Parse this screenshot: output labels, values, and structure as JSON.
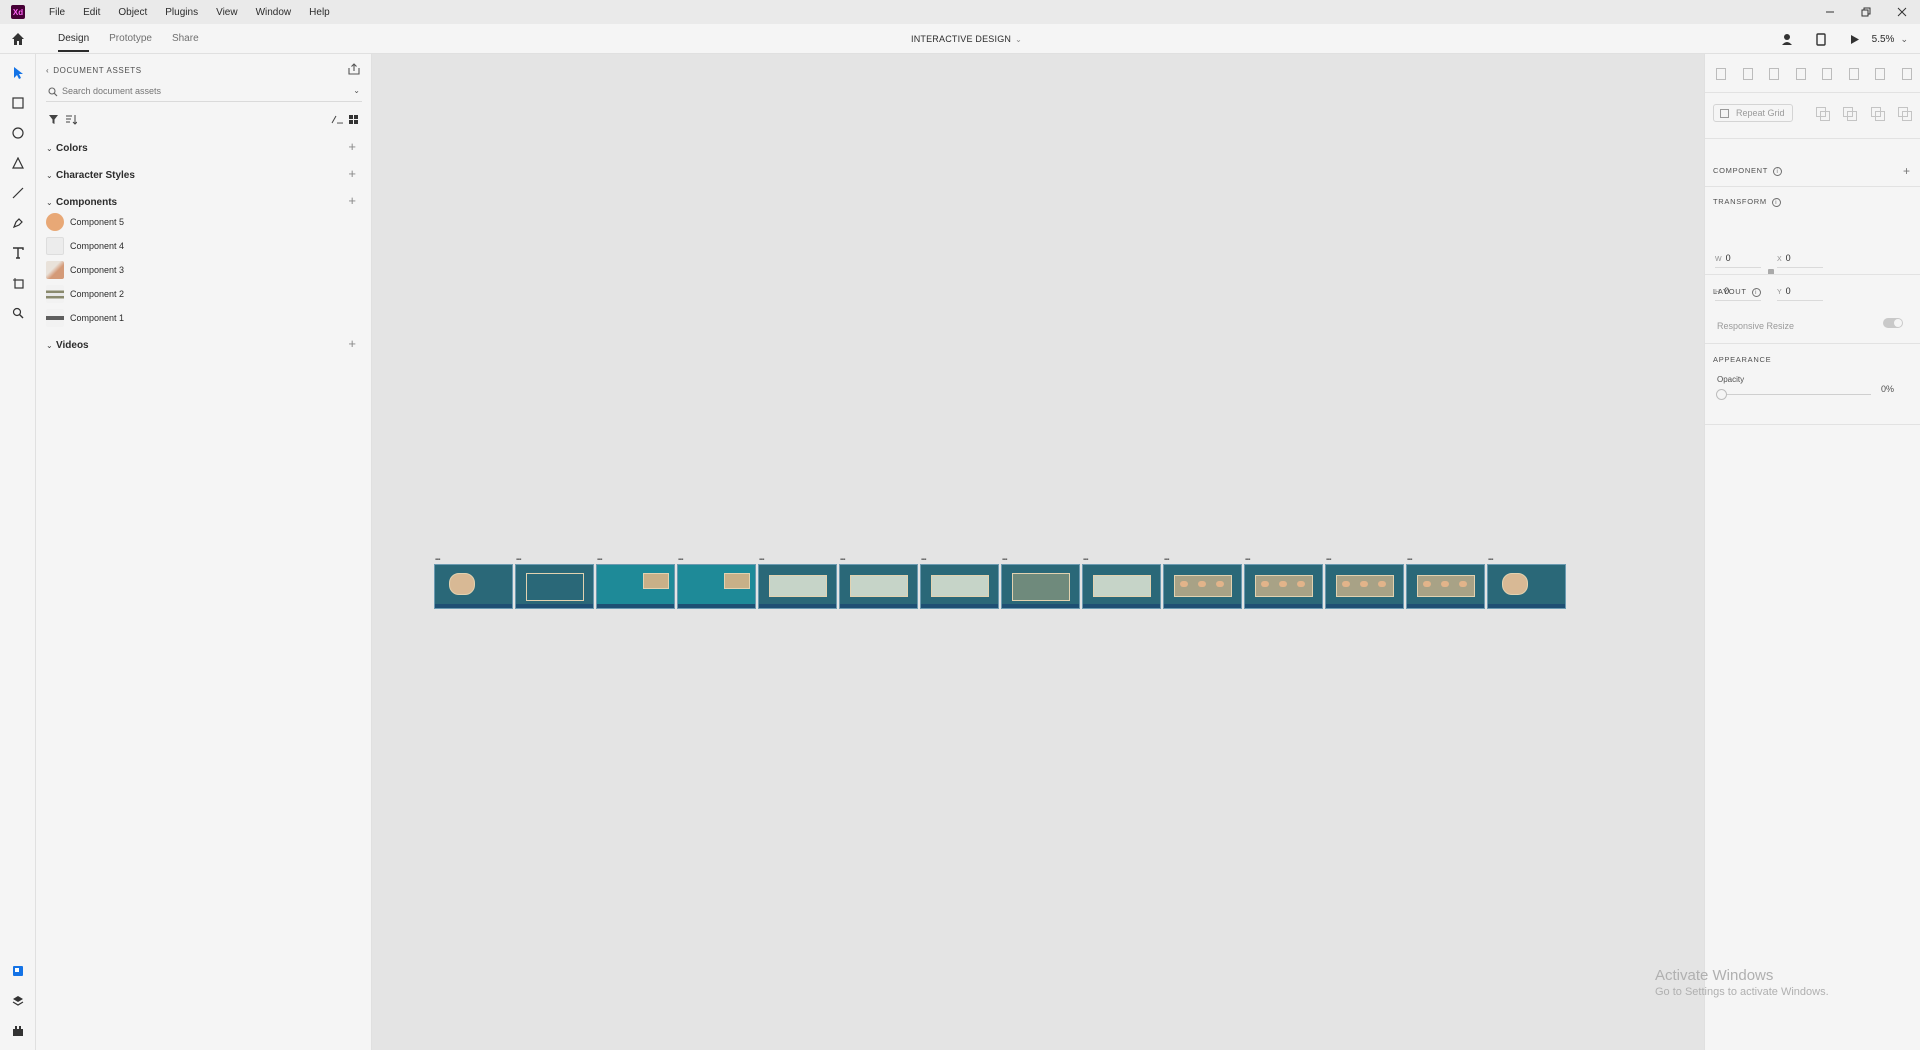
{
  "app": {
    "logo_text": "Xd"
  },
  "menu": [
    "File",
    "Edit",
    "Object",
    "Plugins",
    "View",
    "Window",
    "Help"
  ],
  "tabs": {
    "design": "Design",
    "prototype": "Prototype",
    "share": "Share"
  },
  "document_title": "INTERACTIVE DESIGN",
  "zoom": "5.5%",
  "assets": {
    "header": "DOCUMENT ASSETS",
    "search_placeholder": "Search document assets",
    "sections": {
      "colors": "Colors",
      "character_styles": "Character Styles",
      "components": "Components",
      "videos": "Videos"
    },
    "components": [
      {
        "label": "Component 5",
        "thumb": "#e8a876"
      },
      {
        "label": "Component 4",
        "thumb": "#e6e6e6"
      },
      {
        "label": "Component 3",
        "thumb": "#d8c4b0"
      },
      {
        "label": "Component 2",
        "thumb": "#8a8a6e"
      },
      {
        "label": "Component 1",
        "thumb": "#6e6e6e"
      }
    ]
  },
  "artboards_count": 14,
  "properties": {
    "repeat_grid": "Repeat Grid",
    "component": "COMPONENT",
    "transform": "TRANSFORM",
    "w_label": "W",
    "w_value": "0",
    "x_label": "X",
    "x_value": "0",
    "h_label": "H",
    "h_value": "0",
    "y_label": "Y",
    "y_value": "0",
    "layout": "LAYOUT",
    "responsive_resize": "Responsive Resize",
    "appearance": "APPEARANCE",
    "opacity_label": "Opacity",
    "opacity_value": "0%"
  },
  "watermark": {
    "title": "Activate Windows",
    "subtitle": "Go to Settings to activate Windows."
  },
  "colors": {
    "artboard_bg": "#2a6878",
    "accent_dark": "#2c2c2c"
  }
}
